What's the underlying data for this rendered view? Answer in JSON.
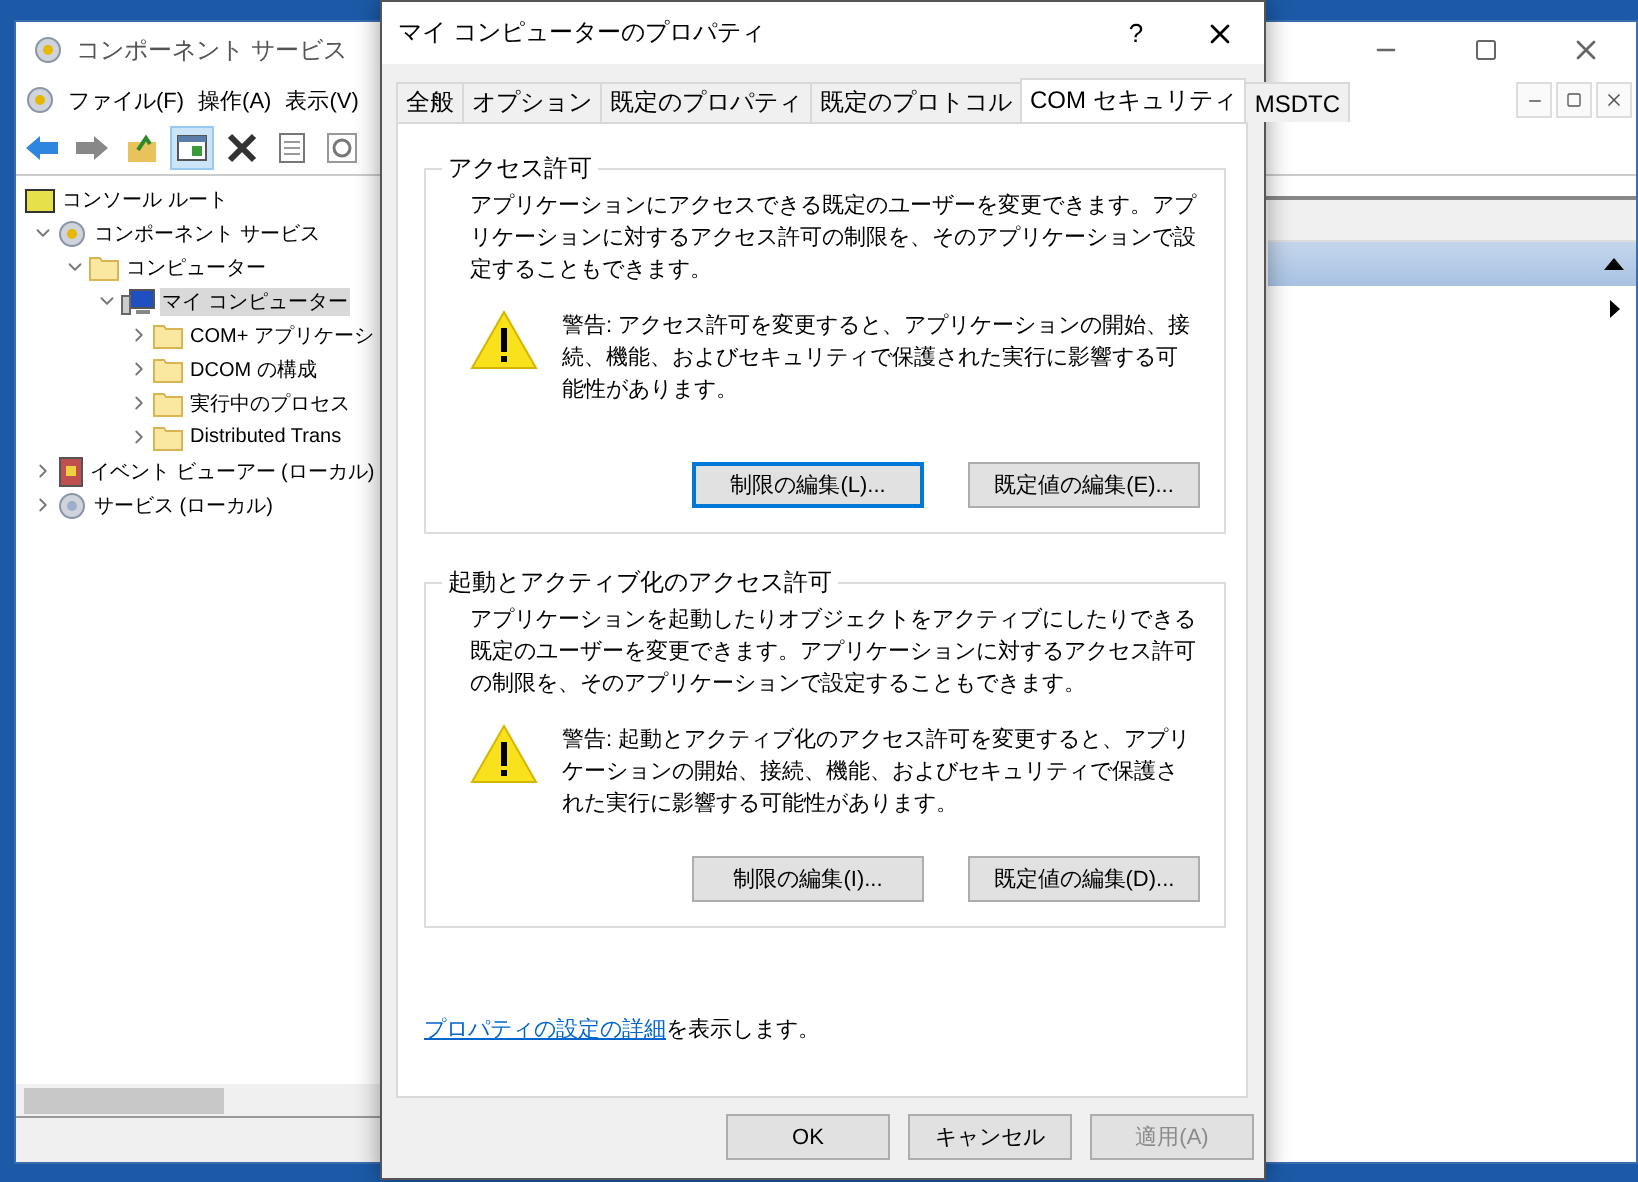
{
  "main_window": {
    "title": "コンポーネント サービス",
    "menu": [
      "ファイル(F)",
      "操作(A)",
      "表示(V)"
    ],
    "toolbar": [
      {
        "kind": "back",
        "pressed": false
      },
      {
        "kind": "forward",
        "pressed": false
      },
      {
        "kind": "up",
        "pressed": false
      },
      {
        "kind": "console",
        "pressed": true
      },
      {
        "kind": "delete",
        "pressed": false
      },
      {
        "kind": "properties",
        "pressed": false
      },
      {
        "kind": "refresh",
        "pressed": false
      }
    ],
    "tree": [
      {
        "label": "コンソール ルート",
        "kind": "console",
        "selected": false,
        "children": [
          {
            "label": "コンポーネント サービス",
            "kind": "component",
            "selected": false,
            "expanded": true,
            "children": [
              {
                "label": "コンピューター",
                "kind": "folder",
                "selected": false,
                "expanded": true,
                "children": [
                  {
                    "label": "マイ コンピューター",
                    "kind": "computer",
                    "selected": true,
                    "expanded": true,
                    "children": [
                      {
                        "label": "COM+ アプリケーシ",
                        "kind": "folder",
                        "selected": false,
                        "expanded": false
                      },
                      {
                        "label": "DCOM の構成",
                        "kind": "folder",
                        "selected": false,
                        "expanded": false
                      },
                      {
                        "label": "実行中のプロセス",
                        "kind": "folder",
                        "selected": false,
                        "expanded": false
                      },
                      {
                        "label": "Distributed Trans",
                        "kind": "folder",
                        "selected": false,
                        "expanded": false
                      }
                    ]
                  }
                ]
              }
            ]
          },
          {
            "label": "イベント ビューアー (ローカル)",
            "kind": "event",
            "selected": false,
            "expanded": false
          },
          {
            "label": "サービス (ローカル)",
            "kind": "service",
            "selected": false,
            "expanded": false
          }
        ]
      }
    ]
  },
  "dialog": {
    "title": "マイ コンピューターのプロパティ",
    "help": "?",
    "tabs": [
      {
        "label": "全般",
        "selected": false
      },
      {
        "label": "オプション",
        "selected": false
      },
      {
        "label": "既定のプロパティ",
        "selected": false
      },
      {
        "label": "既定のプロトコル",
        "selected": false
      },
      {
        "label": "COM セキュリティ",
        "selected": true
      },
      {
        "label": "MSDTC",
        "selected": false
      }
    ],
    "sections": [
      {
        "title": "アクセス許可",
        "description": "アプリケーションにアクセスできる既定のユーザーを変更できます。アプリケーションに対するアクセス許可の制限を、そのアプリケーションで設定することもできます。",
        "warning": "警告: アクセス許可を変更すると、アプリケーションの開始、接続、機能、およびセキュリティで保護された実行に影響する可能性があります。",
        "buttons": [
          {
            "label": "制限の編集(L)...",
            "focused": true
          },
          {
            "label": "既定値の編集(E)...",
            "focused": false
          }
        ]
      },
      {
        "title": "起動とアクティブ化のアクセス許可",
        "description": "アプリケーションを起動したりオブジェクトをアクティブにしたりできる既定のユーザーを変更できます。アプリケーションに対するアクセス許可の制限を、そのアプリケーションで設定することもできます。",
        "warning": "警告: 起動とアクティブ化のアクセス許可を変更すると、アプリケーションの開始、接続、機能、およびセキュリティで保護された実行に影響する可能性があります。",
        "buttons": [
          {
            "label": "制限の編集(I)...",
            "focused": false
          },
          {
            "label": "既定値の編集(D)...",
            "focused": false
          }
        ]
      }
    ],
    "help_link": "プロパティの設定の詳細",
    "help_text": "を表示します。",
    "buttons": [
      {
        "label": "OK",
        "disabled": false
      },
      {
        "label": "キャンセル",
        "disabled": false
      },
      {
        "label": "適用(A)",
        "disabled": true
      }
    ]
  }
}
